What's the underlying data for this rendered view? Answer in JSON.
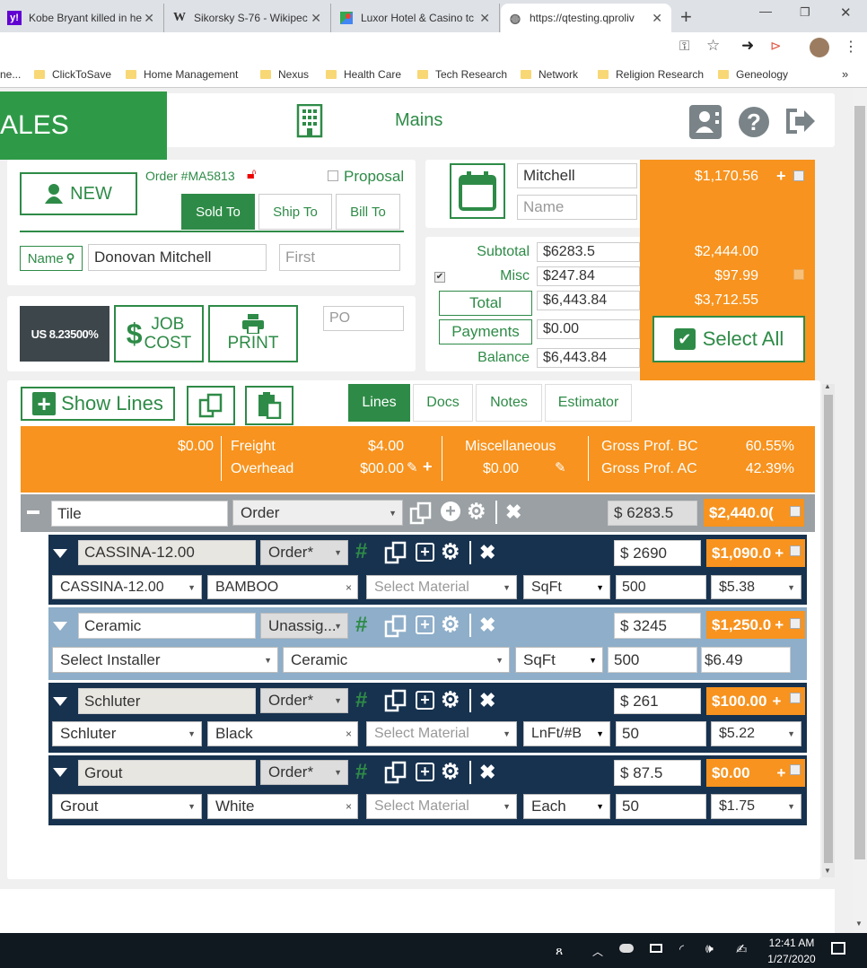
{
  "tabs": [
    {
      "label": "Kobe Bryant killed in he",
      "icon": "yahoo-icon"
    },
    {
      "label": "Sikorsky S-76 - Wikipec",
      "icon": "wikipedia-icon"
    },
    {
      "label": "Luxor Hotel & Casino tc",
      "icon": "maps-icon"
    },
    {
      "label": "https://qtesting.qproliv",
      "icon": "globe-icon"
    }
  ],
  "bookmarks": [
    "ne...",
    "ClickToSave",
    "Home Management",
    "Nexus",
    "Health Care",
    "Tech Research",
    "Network",
    "Religion Research",
    "Geneology"
  ],
  "header": {
    "brand": "ALES",
    "location": "Mains"
  },
  "order": {
    "new_label": "NEW",
    "order_no": "Order #MA5813",
    "proposal_label": "Proposal",
    "tabs": [
      "Sold To",
      "Ship To",
      "Bill To"
    ],
    "name_label": "Name",
    "name_value": "Donovan Mitchell",
    "first_placeholder": "First",
    "tax_label": "US 8.23500%",
    "job_cost_label_1": "JOB",
    "job_cost_label_2": "COST",
    "print_label": "PRINT",
    "po_placeholder": "PO"
  },
  "schedule": {
    "name1": "Mitchell",
    "name2_placeholder": "Name"
  },
  "totals": {
    "subtotal_label": "Subtotal",
    "subtotal_value": "$6283.5",
    "misc_label": "Misc",
    "misc_value": "$247.84",
    "total_label": "Total",
    "total_value": "$6,443.84",
    "payments_label": "Payments",
    "payments_value": "$0.00",
    "balance_label": "Balance",
    "balance_value": "$6,443.84"
  },
  "side": {
    "v1": "$1,170.56",
    "v2": "$2,444.00",
    "v3": "$97.99",
    "v4": "$3,712.55",
    "select_all": "Select All"
  },
  "lines_toolbar": {
    "show_lines": "Show Lines",
    "tabs": [
      "Lines",
      "Docs",
      "Notes",
      "Estimator"
    ]
  },
  "summary": {
    "a": "$0.00",
    "freight_label": "Freight",
    "freight_value": "$4.00",
    "overhead_label": "Overhead",
    "overhead_value": "$00.00",
    "misc_label": "Miscellaneous",
    "misc_value": "$0.00",
    "gpbc_label": "Gross Prof. BC",
    "gpbc_value": "60.55%",
    "gpac_label": "Gross Prof. AC",
    "gpac_value": "42.39%"
  },
  "group": {
    "name": "Tile",
    "status": "Order",
    "amount": "6283.5",
    "price": "$2,440.0("
  },
  "lines": [
    {
      "name": "CASSINA-12.00",
      "status": "Order*",
      "amount": "2690",
      "price": "$1,090.0",
      "product": "CASSINA-12.00",
      "color": "BAMBOO",
      "material": "Select Material",
      "unit": "SqFt",
      "qty": "500",
      "rate": "$5.38"
    },
    {
      "name": "Ceramic",
      "status": "Unassig...",
      "amount": "3245",
      "price": "$1,250.0",
      "product": "Select Installer",
      "color": "Ceramic",
      "material": "",
      "unit": "SqFt",
      "qty": "500",
      "rate": "$6.49"
    },
    {
      "name": "Schluter",
      "status": "Order*",
      "amount": "261",
      "price": "$100.00",
      "product": "Schluter",
      "color": "Black",
      "material": "Select Material",
      "unit": "LnFt/#B",
      "qty": "50",
      "rate": "$5.22"
    },
    {
      "name": "Grout",
      "status": "Order*",
      "amount": "87.5",
      "price": "$0.00",
      "product": "Grout",
      "color": "White",
      "material": "Select Material",
      "unit": "Each",
      "qty": "50",
      "rate": "$1.75"
    }
  ],
  "taskbar": {
    "time": "12:41 AM",
    "date": "1/27/2020"
  },
  "colors": {
    "green": "#2e8b47",
    "orange": "#f7931e",
    "navy": "#17324f",
    "lightblue": "#8eaec9"
  }
}
